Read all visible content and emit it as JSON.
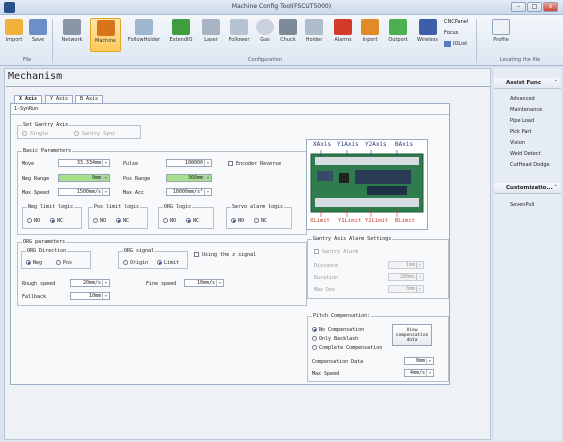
{
  "window": {
    "title": "Machine Config Tool(FSCUT5000)",
    "minimize": "–",
    "maximize": "□",
    "close": "x"
  },
  "ribbon": {
    "buttons": [
      {
        "label": "Import"
      },
      {
        "label": "Save"
      },
      {
        "label": "Network"
      },
      {
        "label": "Machine"
      },
      {
        "label": "FollowHolder"
      },
      {
        "label": "ExtendIO"
      },
      {
        "label": "Laser"
      },
      {
        "label": "Follower"
      },
      {
        "label": "Gas"
      },
      {
        "label": "Chuck"
      },
      {
        "label": "Holder"
      },
      {
        "label": "Alarms"
      },
      {
        "label": "Inport"
      },
      {
        "label": "Outport"
      },
      {
        "label": "Wireless"
      },
      {
        "label": "Profile"
      }
    ],
    "side_items": [
      "CNCPanel",
      "Focus",
      "IOList"
    ],
    "groups": [
      "File",
      "Configuration",
      "Locating the file"
    ]
  },
  "page": {
    "title": "Mechanism"
  },
  "tabs": [
    "X Axis",
    "Y Axis",
    "B Axis"
  ],
  "subtab": "1-SynRun",
  "gantry": {
    "legend": "Set Gantry Axis",
    "opt_single": "Single",
    "opt_sync": "Gantry Sync"
  },
  "basic": {
    "legend": "Basic Parameters",
    "move_label": "Move",
    "move_value": "33.334mm",
    "pulse_label": "Pulse",
    "pulse_value": "100000",
    "encoder_label": "Encoder Reverse",
    "neg_range_label": "Neg Range",
    "neg_range_value": "0mm",
    "pos_range_label": "Pos Range",
    "pos_range_value": "360mm",
    "max_speed_label": "Max Speed",
    "max_speed_value": "1500mm/s",
    "max_acc_label": "Max Acc",
    "max_acc_value": "10000mm/s²"
  },
  "logic": {
    "neg_label": "Neg limit logic",
    "pos_label": "Pos limit logic",
    "org_label": "ORG logic",
    "servo_label": "Servo alarm logic",
    "no": "NO",
    "nc": "NC"
  },
  "org": {
    "legend": "ORG parameters",
    "dir_label": "ORG Direction",
    "neg": "Neg",
    "pos": "Pos",
    "signal_label": "ORG signal",
    "origin": "Origin",
    "limit": "Limit",
    "z_signal_label": "Using the z signal",
    "rough_label": "Rough speed",
    "rough_value": "20mm/s",
    "fine_label": "Fine speed",
    "fine_value": "10mm/s",
    "fallback_label": "Fallback",
    "fallback_value": "10mm"
  },
  "board": {
    "top_labels": [
      "XAxis",
      "Y1Axis",
      "Y2Axis",
      "BAxis"
    ],
    "bottom_labels": [
      "XLimit",
      "Y1Limit",
      "Y2Limit",
      "BLimit"
    ]
  },
  "gantry_alarm": {
    "legend": "Gantry Axis Alarm Settings",
    "checkbox": "Gantry Alarm",
    "rows": [
      {
        "label": "Distance",
        "value": "1mm"
      },
      {
        "label": "Duration",
        "value": "200ms"
      },
      {
        "label": "Max Dev",
        "value": "3mm"
      }
    ]
  },
  "pitch": {
    "legend": "Pitch Compensation:",
    "opt1": "No Compensation",
    "opt2": "Only Backlash",
    "opt3": "Complete Compensation",
    "view_btn": "View compensation data",
    "comp_data_label": "Compensation Data",
    "comp_data_value": "0mm",
    "max_speed_label": "Max Speed",
    "max_speed_value": "4mm/s"
  },
  "sidebar": {
    "assist_title": "Assist Func",
    "assist_items": [
      "Advanced",
      "Maintenance",
      "Pipe Load",
      "Pick Part",
      "Vision",
      "Weld Detect",
      "CutHead Dodge"
    ],
    "custom_title": "Customizatio...",
    "custom_items": [
      "SevenPull"
    ]
  }
}
